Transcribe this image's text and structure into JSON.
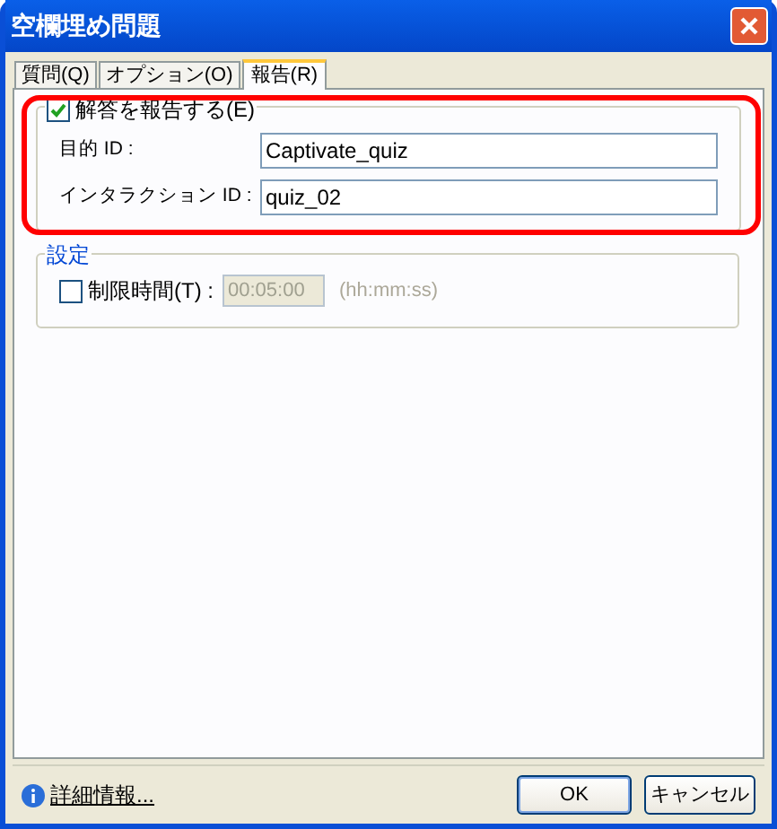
{
  "window": {
    "title": "空欄埋め問題"
  },
  "tabs": [
    {
      "label": "質問(Q)",
      "selected": false
    },
    {
      "label": "オプション(O)",
      "selected": false
    },
    {
      "label": "報告(R)",
      "selected": true
    }
  ],
  "report": {
    "label": "解答を報告する(E)",
    "checked": true,
    "highlighted": true,
    "fields": [
      {
        "label": "目的 ID :",
        "value": "Captivate_quiz"
      },
      {
        "label": "インタラクション ID :",
        "value": "quiz_02"
      }
    ]
  },
  "settings": {
    "title": "設定",
    "time_limit": {
      "label": "制限時間(T) :",
      "checked": false,
      "value": "00:05:00",
      "disabled": true,
      "hint": "(hh:mm:ss)"
    }
  },
  "footer": {
    "link": "詳細情報...",
    "buttons": [
      "OK",
      "キャンセル"
    ]
  }
}
